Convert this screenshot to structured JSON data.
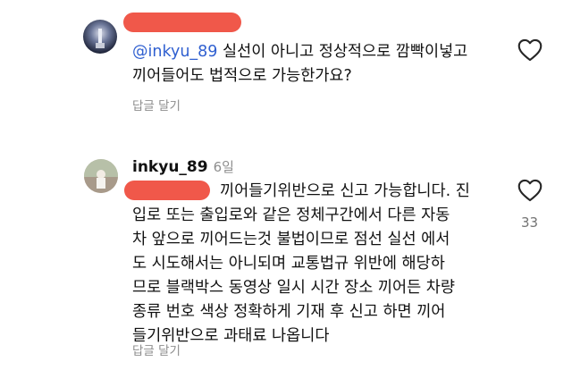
{
  "comments": [
    {
      "mention": "@inkyu_89",
      "text": " 실선이 아니고 정상적으로 깜빡이넣고 끼어들어도 법적으로 가능한가요?",
      "reply_label": "답글 달기"
    },
    {
      "username": "inkyu_89",
      "time": "6일",
      "lines": [
        "끼어들기위반으로 신고 가능합니다. 진",
        "입로 또는 출입로와 같은 정체구간에서 다른 자동",
        "차 앞으로 끼어드는것 불법이므로 점선 실선 에서",
        "도 시도해서는 아니되며 교통법규 위반에 해당하",
        "므로 블랙박스 동영상 일시 시간 장소 끼어든 차량",
        "종류 번호 색상 정확하게 기재 후 신고 하면 끼어",
        "들기위반으로 과태료 나옵니다"
      ],
      "likes": "33",
      "reply_label": "답글 달기"
    }
  ],
  "colors": {
    "redaction": "#f0584a",
    "mention": "#2f5fd0",
    "secondary_text": "#8e8e8e"
  },
  "icons": [
    "heart-icon"
  ]
}
